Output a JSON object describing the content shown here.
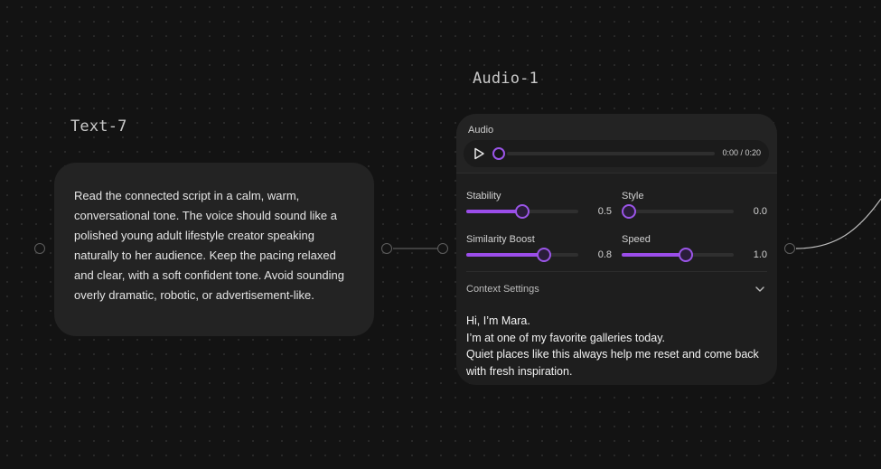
{
  "canvas": {
    "background": "#131313",
    "accent": "#9b4dea"
  },
  "text_node": {
    "title": "Text-7",
    "content": "Read the connected script in a calm, warm, conversational tone. The voice should sound like a polished young adult lifestyle creator speaking naturally to her audience. Keep the pacing relaxed and clear, with a soft confident tone. Avoid sounding overly dramatic, robotic, or advertisement-like."
  },
  "audio_node": {
    "title": "Audio-1",
    "audio_label": "Audio",
    "player": {
      "time": "0:00 / 0:20",
      "progress": 0,
      "play_icon": "play-icon"
    },
    "sliders": [
      {
        "label": "Stability",
        "value": "0.5",
        "fraction": 0.5
      },
      {
        "label": "Style",
        "value": "0.0",
        "fraction": 0.0
      },
      {
        "label": "Similarity Boost",
        "value": "0.8",
        "fraction": 0.72
      },
      {
        "label": "Speed",
        "value": "1.0",
        "fraction": 0.58
      }
    ],
    "context": {
      "label": "Context Settings",
      "icon": "chevron-down-icon",
      "lines": [
        "Hi, I’m Mara.",
        "I’m at one of my favorite galleries today.",
        "Quiet places like this always help me reset and come back",
        "with fresh inspiration."
      ]
    }
  }
}
